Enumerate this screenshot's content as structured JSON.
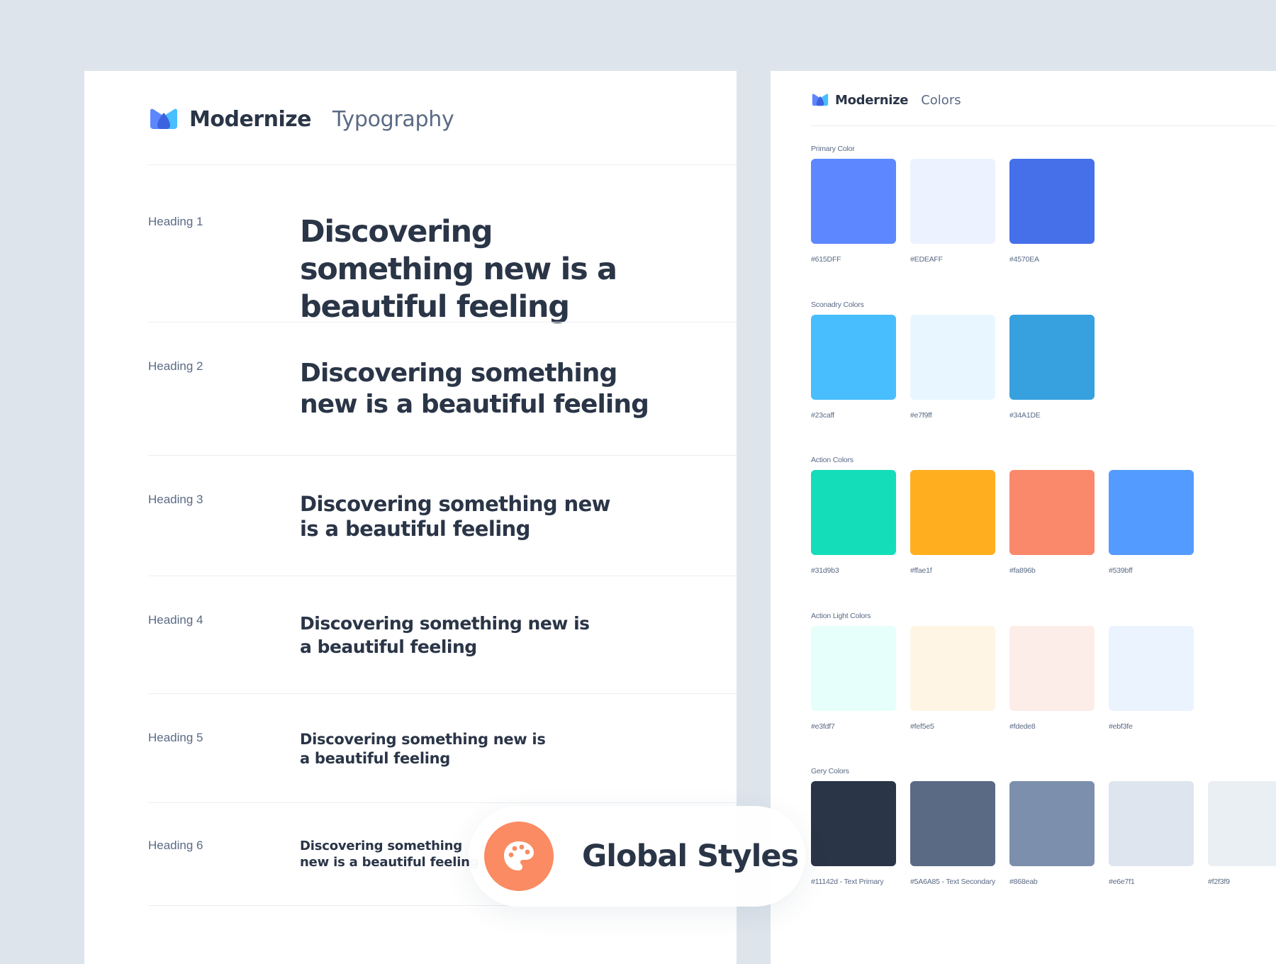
{
  "brand": {
    "name": "Modernize"
  },
  "typography": {
    "title": "Typography",
    "rows": [
      {
        "label": "Heading 1",
        "sample": "Discovering something new is a beautiful feeling"
      },
      {
        "label": "Heading 2",
        "sample": "Discovering something new is a beautiful feeling"
      },
      {
        "label": "Heading 3",
        "sample": "Discovering something new is a beautiful feeling"
      },
      {
        "label": "Heading 4",
        "sample": "Discovering something new is a beautiful feeling"
      },
      {
        "label": "Heading 5",
        "sample": "Discovering something new is a beautiful feeling"
      },
      {
        "label": "Heading 6",
        "sample": "Discovering something new is a beautiful feeling"
      }
    ]
  },
  "colors": {
    "title": "Colors",
    "groups": [
      {
        "label": "Primary Color",
        "swatches": [
          {
            "code": "#615DFF",
            "color": "#5d87ff"
          },
          {
            "code": "#EDEAFF",
            "color": "#ecf2ff"
          },
          {
            "code": "#4570EA",
            "color": "#4570ea"
          }
        ]
      },
      {
        "label": "Sconadry Colors",
        "swatches": [
          {
            "code": "#23caff",
            "color": "#49beff"
          },
          {
            "code": "#e7f9ff",
            "color": "#e8f7ff"
          },
          {
            "code": "#34A1DE",
            "color": "#36a1de"
          }
        ]
      },
      {
        "label": "Action Colors",
        "swatches": [
          {
            "code": "#31d9b3",
            "color": "#13deb9"
          },
          {
            "code": "#ffae1f",
            "color": "#ffae1f"
          },
          {
            "code": "#fa896b",
            "color": "#fa896b"
          },
          {
            "code": "#539bff",
            "color": "#539bff"
          }
        ]
      },
      {
        "label": "Action Light Colors",
        "swatches": [
          {
            "code": "#e3fdf7",
            "color": "#e6fffa"
          },
          {
            "code": "#fef5e5",
            "color": "#fef5e5"
          },
          {
            "code": "#fdede8",
            "color": "#fdede8"
          },
          {
            "code": "#ebf3fe",
            "color": "#ebf3fe"
          }
        ]
      },
      {
        "label": "Gery Colors",
        "swatches": [
          {
            "code": "#11142d - Text Primary",
            "color": "#2a3547"
          },
          {
            "code": "#5A6A85 - Text Secondary",
            "color": "#5a6a85"
          },
          {
            "code": "#868eab",
            "color": "#7c8fac"
          },
          {
            "code": "#e6e7f1",
            "color": "#dfe5ef"
          },
          {
            "code": "#f2f3f9",
            "color": "#eaeff4"
          }
        ]
      }
    ]
  },
  "badge": {
    "label": "Global Styles",
    "accent": "#fb8b62"
  },
  "theme": {
    "background": "#dde4ec",
    "card": "#ffffff",
    "text_primary": "#2a3547",
    "text_secondary": "#5a6a85"
  }
}
